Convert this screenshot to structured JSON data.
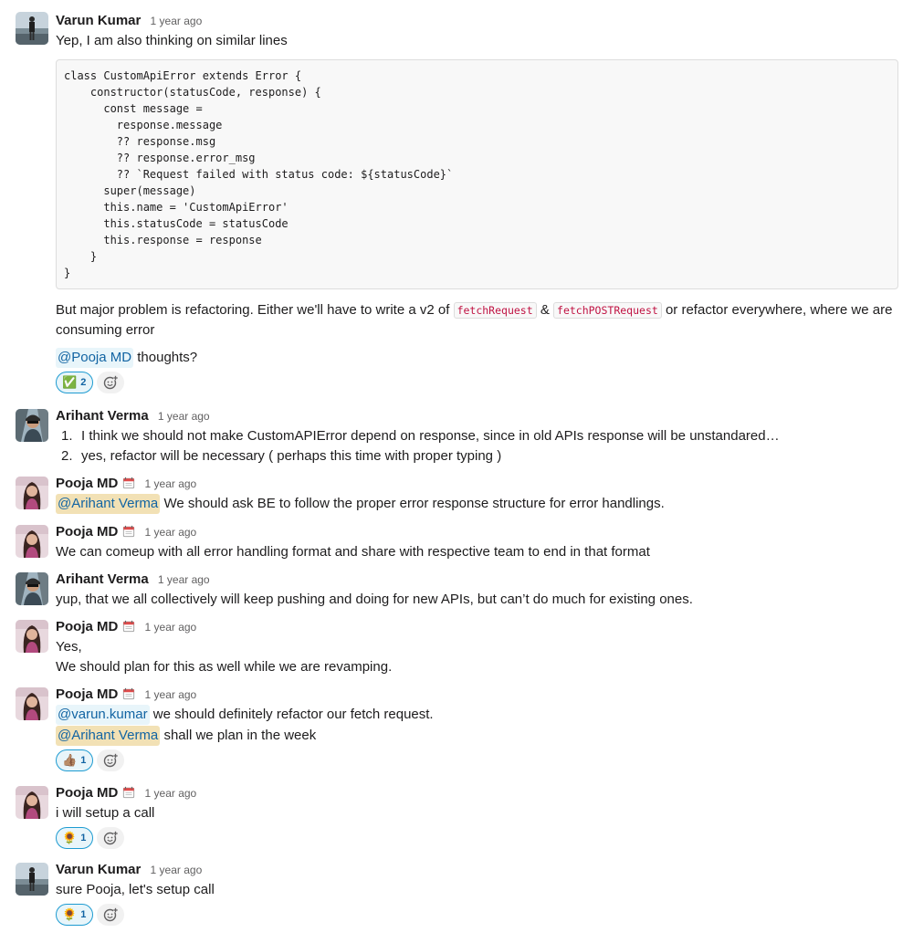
{
  "messages": [
    {
      "author": "Varun Kumar",
      "timestamp": "1 year ago",
      "line1": "Yep, I am also thinking on similar lines",
      "code": "class CustomApiError extends Error {\n    constructor(statusCode, response) {\n      const message =\n        response.message\n        ?? response.msg\n        ?? response.error_msg\n        ?? `Request failed with status code: ${statusCode}`\n      super(message)\n      this.name = 'CustomApiError'\n      this.statusCode = statusCode\n      this.response = response\n    }\n}",
      "para_a": "But major problem is refactoring. Either we'll have to write a v2 of",
      "code_a": "fetchRequest",
      "amp": "&",
      "code_b": "fetchPOSTRequest",
      "para_b": "or refactor everywhere, where we are consuming error",
      "mention": "@Pooja MD",
      "after_mention": "thoughts?",
      "reaction": {
        "emoji": "✅",
        "count": "2"
      }
    },
    {
      "author": "Arihant Verma",
      "timestamp": "1 year ago",
      "items": [
        {
          "num": "1.",
          "text": "I think we should not make CustomAPIError depend on response, since in old APIs response will be unstandared…"
        },
        {
          "num": "2.",
          "text": "yes, refactor will be necessary ( perhaps this time with proper typing )"
        }
      ]
    },
    {
      "author": "Pooja MD",
      "timestamp": "1 year ago",
      "mention": "@Arihant Verma",
      "text": "We should ask BE to follow the proper error response structure for error handlings."
    },
    {
      "author": "Pooja MD",
      "timestamp": "1 year ago",
      "text": "We can comeup with all error handling format and share with respective team to end in that format"
    },
    {
      "author": "Arihant Verma",
      "timestamp": "1 year ago",
      "text": "yup, that we all collectively will keep pushing and doing for new APIs, but can’t do much for existing ones."
    },
    {
      "author": "Pooja MD",
      "timestamp": "1 year ago",
      "line1": "Yes,",
      "line2": "We should plan for this as well while we are revamping."
    },
    {
      "author": "Pooja MD",
      "timestamp": "1 year ago",
      "mention1": "@varun.kumar",
      "text1": "we should definitely refactor our fetch request.",
      "mention2": "@Arihant Verma",
      "text2": "shall we plan in the week",
      "reaction": {
        "emoji": "👍🏽",
        "count": "1"
      }
    },
    {
      "author": "Pooja MD",
      "timestamp": "1 year ago",
      "text": "i will setup a call",
      "reaction": {
        "emoji": "🌻",
        "count": "1"
      }
    },
    {
      "author": "Varun Kumar",
      "timestamp": "1 year ago",
      "text": "sure Pooja, let's setup call",
      "reaction": {
        "emoji": "🌻",
        "count": "1"
      }
    }
  ],
  "icons": {
    "status": "calendar-icon",
    "add_reaction": "add-reaction-icon"
  },
  "colors": {
    "link": "#1264a3",
    "mention_bg": "#e8f5fa",
    "self_mention_bg": "#f2e1b5",
    "code_red": "#c01343",
    "timestamp": "#616061"
  }
}
